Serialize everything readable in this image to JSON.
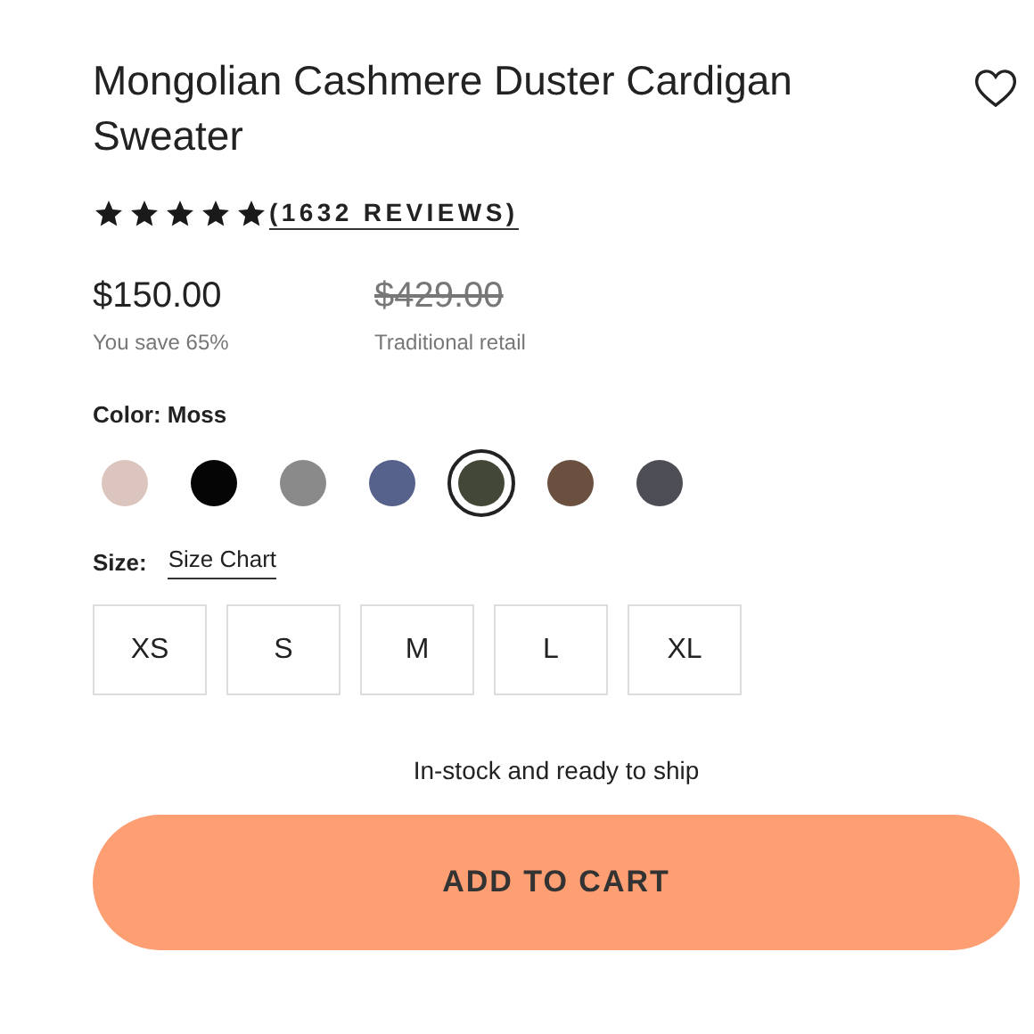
{
  "product": {
    "title": "Mongolian Cashmere Duster Cardigan Sweater",
    "favorited": false
  },
  "rating": {
    "stars": 5,
    "reviews": "(1632 REVIEWS)"
  },
  "price": {
    "current": "$150.00",
    "savings": "You save 65%",
    "original": "$429.00",
    "original_label": "Traditional retail"
  },
  "color": {
    "label": "Color: Moss",
    "swatches": [
      {
        "color": "#dcc5bf",
        "selected": false
      },
      {
        "color": "#050505",
        "selected": false
      },
      {
        "color": "#8a8a8a",
        "selected": false
      },
      {
        "color": "#56628c",
        "selected": false
      },
      {
        "color": "#434737",
        "selected": true
      },
      {
        "color": "#6b5040",
        "selected": false
      },
      {
        "color": "#4d4d55",
        "selected": false
      }
    ]
  },
  "size": {
    "label": "Size:",
    "chart_link": "Size Chart",
    "options": [
      {
        "label": "XS",
        "selected": false
      },
      {
        "label": "S",
        "selected": false
      },
      {
        "label": "M",
        "selected": false
      },
      {
        "label": "L",
        "selected": false
      },
      {
        "label": "XL",
        "selected": false
      }
    ]
  },
  "stock": "In-stock and ready to ship",
  "cart_button": "ADD TO CART"
}
